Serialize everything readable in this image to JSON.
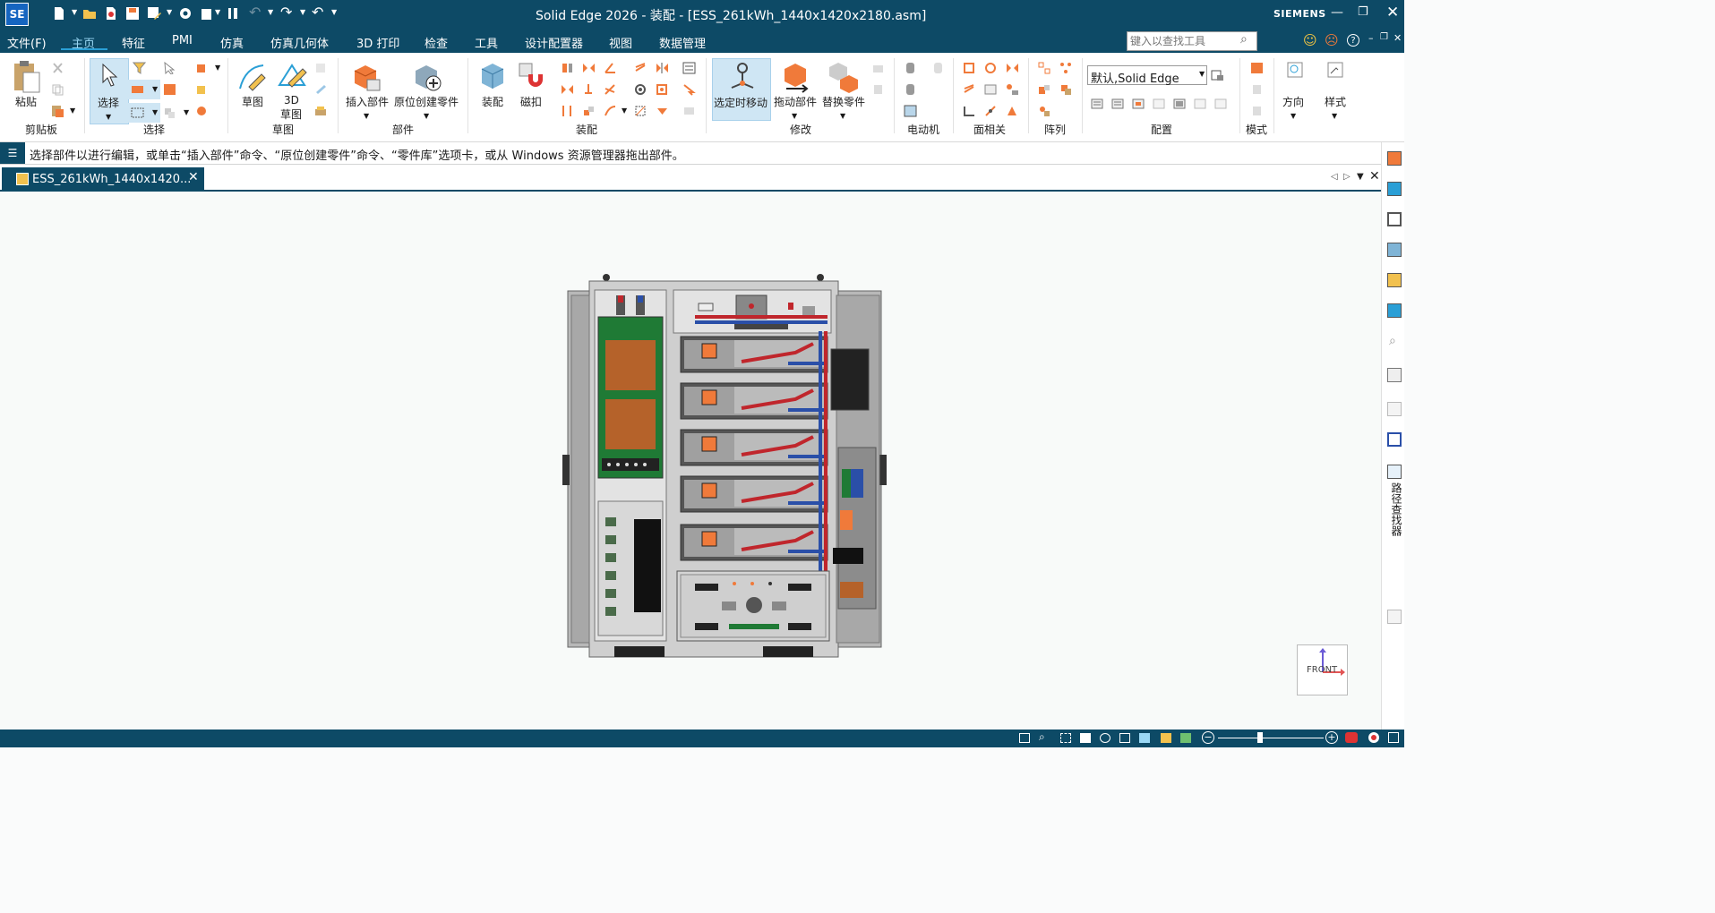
{
  "title_bar": {
    "app_logo": "SE",
    "title": "Solid Edge 2026 - 装配 - [ESS_261kWh_1440x1420x2180.asm]",
    "brand": "SIEMENS"
  },
  "menu": {
    "file": "文件(F)",
    "tabs": [
      "主页",
      "特征",
      "PMI",
      "仿真",
      "仿真几何体",
      "3D 打印",
      "检查",
      "工具",
      "设计配置器",
      "视图",
      "数据管理"
    ],
    "active_tab": "主页",
    "search_placeholder": "键入以查找工具"
  },
  "ribbon": {
    "groups": {
      "clipboard": "剪贴板",
      "select": "选择",
      "sketch": "草图",
      "parts": "部件",
      "assemble": "装配",
      "modify": "修改",
      "motor": "电动机",
      "face_relate": "面相关",
      "pattern": "阵列",
      "config": "配置",
      "modes": "模式"
    },
    "buttons": {
      "paste": "粘贴",
      "select": "选择",
      "sketch": "草图",
      "sketch_3d_line1": "3D",
      "sketch_3d_line2": "草图",
      "insert_part": "插入部件",
      "create_in_place": "原位创建零件",
      "assemble": "装配",
      "snap": "磁扣",
      "move_on_select": "选定时移动",
      "drag_component": "拖动部件",
      "replace_part": "替换零件",
      "orientation": "方向",
      "style": "样式"
    },
    "config_dropdown_value": "默认,Solid Edge"
  },
  "prompt_bar": {
    "text": "选择部件以进行编辑，或单击“插入部件”命令、“原位创建零件”命令、“零件库”选项卡，或从 Windows 资源管理器拖出部件。"
  },
  "document_tab": {
    "label": "ESS_261kWh_1440x1420..."
  },
  "viewport": {
    "view_cube_label": "FRONT"
  },
  "right_dock": {
    "vertical_label": "路径查找器"
  },
  "colors": {
    "titlebar": "#0d4a66",
    "accent_tab_underline": "#2a9fd6",
    "cable_red": "#c0262c",
    "cable_blue": "#2a4fa8",
    "copper": "#b5622a",
    "pcb_green": "#1f7a35"
  }
}
